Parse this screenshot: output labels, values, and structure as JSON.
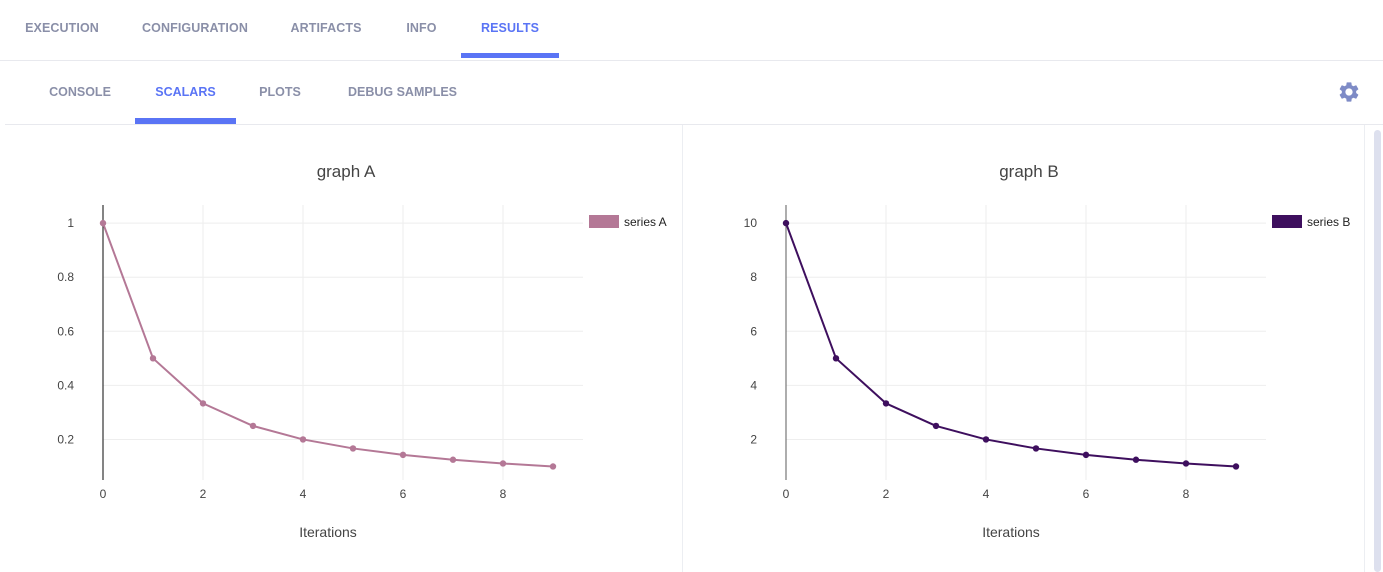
{
  "top_tabs": [
    {
      "label": "EXECUTION",
      "active": false
    },
    {
      "label": "CONFIGURATION",
      "active": false
    },
    {
      "label": "ARTIFACTS",
      "active": false
    },
    {
      "label": "INFO",
      "active": false
    },
    {
      "label": "RESULTS",
      "active": true
    }
  ],
  "sub_tabs": [
    {
      "label": "CONSOLE",
      "active": false
    },
    {
      "label": "SCALARS",
      "active": true
    },
    {
      "label": "PLOTS",
      "active": false
    },
    {
      "label": "DEBUG SAMPLES",
      "active": false
    }
  ],
  "settings_icon": "gear-icon",
  "colors": {
    "accent": "#5a74f5",
    "tab_inactive": "#8a8fa8",
    "gear": "#7e8bc6"
  },
  "chart_data": [
    {
      "type": "line",
      "title": "graph A",
      "xlabel": "Iterations",
      "ylabel": "",
      "x": [
        0,
        1,
        2,
        3,
        4,
        5,
        6,
        7,
        8,
        9
      ],
      "series": [
        {
          "name": "series A",
          "color": "#b47896",
          "values": [
            1,
            0.5,
            0.3333,
            0.25,
            0.2,
            0.1667,
            0.1429,
            0.125,
            0.1111,
            0.1
          ]
        }
      ],
      "xticks": [
        0,
        2,
        4,
        6,
        8
      ],
      "yticks": [
        0.2,
        0.4,
        0.6,
        0.8,
        1
      ],
      "ytick_labels": [
        "0.2",
        "0.4",
        "0.6",
        "0.8",
        "1"
      ],
      "xlim": [
        0,
        9.6
      ],
      "ylim": [
        0.05,
        1.067
      ],
      "grid": true,
      "legend": "top-right"
    },
    {
      "type": "line",
      "title": "graph B",
      "xlabel": "Iterations",
      "ylabel": "",
      "x": [
        0,
        1,
        2,
        3,
        4,
        5,
        6,
        7,
        8,
        9
      ],
      "series": [
        {
          "name": "series B",
          "color": "#3e0f5e",
          "values": [
            10,
            5,
            3.333,
            2.5,
            2,
            1.667,
            1.429,
            1.25,
            1.111,
            1
          ]
        }
      ],
      "xticks": [
        0,
        2,
        4,
        6,
        8
      ],
      "yticks": [
        2,
        4,
        6,
        8,
        10
      ],
      "ytick_labels": [
        "2",
        "4",
        "6",
        "8",
        "10"
      ],
      "xlim": [
        0,
        9.6
      ],
      "ylim": [
        0.5,
        10.67
      ],
      "grid": true,
      "legend": "top-right"
    }
  ]
}
